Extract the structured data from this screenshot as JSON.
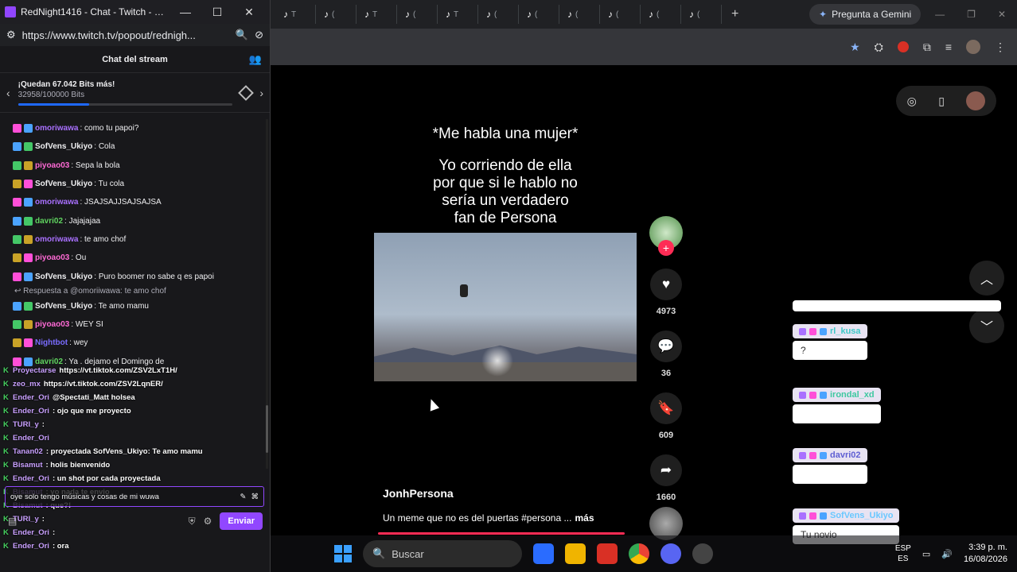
{
  "twitch": {
    "window_title": "RedNight1416 - Chat - Twitch - Goo...",
    "url": "https://www.twitch.tv/popout/rednigh...",
    "header": "Chat del stream",
    "goal_title": "¡Quedan 67.042 Bits más!",
    "goal_progress": "32958/100000 Bits",
    "goal_fraction": 0.33,
    "messages": [
      {
        "name": "omoriwawa",
        "color": "#a970ff",
        "text": ": como tu papoi?"
      },
      {
        "name": "SofVens_Ukiyo",
        "color": "#efeff1",
        "text": ": Cola"
      },
      {
        "name": "piyoao03",
        "color": "#ff6ad5",
        "text": ": Sepa la bola"
      },
      {
        "name": "SofVens_Ukiyo",
        "color": "#efeff1",
        "text": ": Tu cola"
      },
      {
        "name": "omoriwawa",
        "color": "#a970ff",
        "text": ": JSAJSAJJSAJSAJSA"
      },
      {
        "name": "davri02",
        "color": "#5fd35f",
        "text": ": Jajajajaa"
      },
      {
        "name": "omoriwawa",
        "color": "#a970ff",
        "text": ": te amo chof"
      },
      {
        "name": "piyoao03",
        "color": "#ff6ad5",
        "text": ": Ou"
      },
      {
        "name": "SofVens_Ukiyo",
        "color": "#efeff1",
        "text": ": Puro boomer no sabe q es papoi"
      }
    ],
    "reply_label": "Respuesta a @omoriiwawa: te amo chof",
    "messages2": [
      {
        "name": "SofVens_Ukiyo",
        "color": "#efeff1",
        "text": ": Te amo mamu"
      },
      {
        "name": "piyoao03",
        "color": "#ff6ad5",
        "text": ": WEY SI"
      },
      {
        "name": "Nightbot",
        "color": "#7a6cff",
        "text": ": wey"
      },
      {
        "name": "davri02",
        "color": "#5fd35f",
        "text": ": Ya . dejamo el Domingo de"
      }
    ],
    "input_text": "oye     solo tengo músicas y cosas de mi wuwa",
    "send_label": "Enviar"
  },
  "overlay_chat": [
    {
      "name": "Proyectarse",
      "text": "https://vt.tiktok.com/ZSV2LxT1H/"
    },
    {
      "name": "zeo_mx",
      "text": "https://vt.tiktok.com/ZSV2LqnER/"
    },
    {
      "name": "Ender_Ori",
      "text": "@Spectati_Matt holsea"
    },
    {
      "name": "Ender_Ori",
      "text": ": ojo que me proyecto"
    },
    {
      "name": "TURI_y",
      "text": ":"
    },
    {
      "name": "Ender_Ori",
      "text": ""
    },
    {
      "name": "Tanan02",
      "text": ": proyectada   SofVens_Ukiyo: Te amo mamu"
    },
    {
      "name": "Bisamut",
      "text": ": holis bienvenido"
    },
    {
      "name": "Ender_Ori",
      "text": ": un shot por cada proyectada"
    },
    {
      "name": "Bisamut",
      "text": ": yo nada te envio"
    },
    {
      "name": "Bisamut",
      "text": ": que?!"
    },
    {
      "name": "TURI_y",
      "text": ":"
    },
    {
      "name": "Ender_Ori",
      "text": ":"
    },
    {
      "name": "Ender_Ori",
      "text": ": ora"
    }
  ],
  "chrome": {
    "gemini_label": "Pregunta a Gemini",
    "tabs": [
      "T",
      "(",
      "T",
      "(",
      "T",
      "(",
      "(",
      "(",
      "(",
      "(",
      "("
    ]
  },
  "tiktok": {
    "caption_top": "*Me habla una mujer*",
    "caption_body": [
      "Yo corriendo de ella",
      "por que si le hablo no",
      "sería un verdadero",
      "fan de Persona"
    ],
    "likes": "4973",
    "comments": "36",
    "saves": "609",
    "shares": "1660",
    "author": "JonhPersona",
    "description": "Un meme que no es del puertas #persona ...",
    "more": "más"
  },
  "bubbles": [
    {
      "name": "rl_kusa",
      "text": "?"
    },
    {
      "name": "irondal_xd",
      "text": ""
    },
    {
      "name": "davri02",
      "text": ""
    },
    {
      "name": "SofVens_Ukiyo",
      "text": "Tu novio"
    }
  ],
  "taskbar": {
    "search_placeholder": "Buscar",
    "lang_top": "ESP",
    "lang_bottom": "ES",
    "time": "3:39 p. m.",
    "date": "16/08/2026"
  }
}
